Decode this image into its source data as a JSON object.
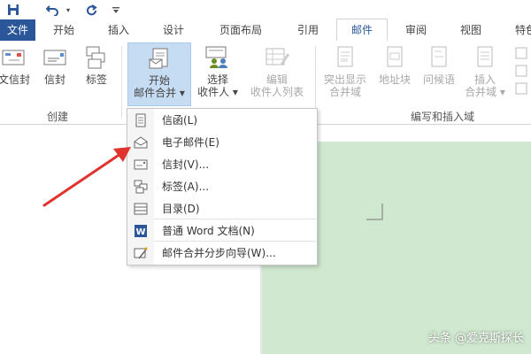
{
  "qat": {
    "save_icon": "save-icon",
    "undo_icon": "undo-icon",
    "redo_icon": "redo-icon",
    "customize_icon": "customize-qat-icon"
  },
  "tabs": [
    {
      "label": "文件",
      "state": "file"
    },
    {
      "label": "开始"
    },
    {
      "label": "插入"
    },
    {
      "label": "设计"
    },
    {
      "label": "页面布局"
    },
    {
      "label": "引用"
    },
    {
      "label": "邮件",
      "state": "active"
    },
    {
      "label": "审阅"
    },
    {
      "label": "视图"
    },
    {
      "label": "特色"
    }
  ],
  "ribbon": {
    "create_group": {
      "label": "创建",
      "buttons": [
        {
          "label": "中文信封",
          "visible_label": "文信封"
        },
        {
          "label": "信封"
        },
        {
          "label": "标签"
        }
      ]
    },
    "start_merge": {
      "line1": "开始",
      "line2": "邮件合并 ▾"
    },
    "select_recipients": {
      "line1": "选择",
      "line2": "收件人 ▾"
    },
    "edit_recipients": {
      "line1": "编辑",
      "line2": "收件人列表"
    },
    "write_insert_group": {
      "label": "编写和插入域",
      "buttons": [
        {
          "line1": "突出显示",
          "line2": "合并域"
        },
        {
          "line1": "地址块",
          "line2": ""
        },
        {
          "line1": "问候语",
          "line2": ""
        },
        {
          "line1": "插入",
          "line2": "合并域 ▾"
        }
      ]
    }
  },
  "menu": {
    "items": [
      {
        "label": "信函(L)",
        "icon": "letter-icon"
      },
      {
        "label": "电子邮件(E)",
        "icon": "email-icon"
      },
      {
        "label": "信封(V)...",
        "icon": "envelope-icon"
      },
      {
        "label": "标签(A)...",
        "icon": "labels-icon"
      },
      {
        "label": "目录(D)",
        "icon": "directory-icon"
      },
      {
        "label": "普通 Word 文档(N)",
        "icon": "word-doc-icon"
      },
      {
        "label": "邮件合并分步向导(W)...",
        "icon": "wizard-icon"
      }
    ]
  },
  "watermark": "头条 @爱克斯探长",
  "colors": {
    "file_tab": "#2b579a",
    "arrow": "#e0332e",
    "doc_page": "#cfe8cf",
    "pressed_button": "#c5dcf2"
  }
}
